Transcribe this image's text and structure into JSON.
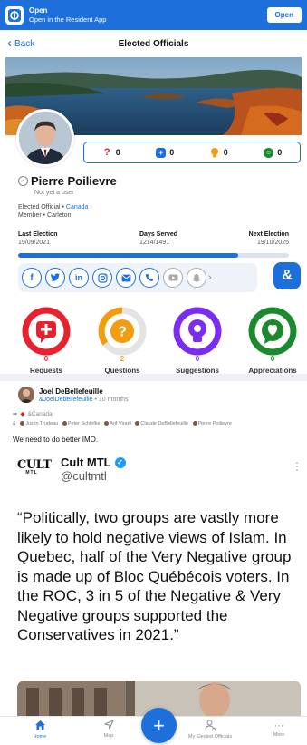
{
  "app_banner": {
    "title": "Open",
    "subtitle": "Open in the Resident App",
    "button": "Open"
  },
  "nav": {
    "back": "Back",
    "title": "Elected Officials"
  },
  "stats": {
    "questions": "0",
    "requests": "0",
    "suggestions": "0",
    "appreciations": "0"
  },
  "profile": {
    "name": "Pierre Poilievre",
    "status": "Not yet a user",
    "elected_prefix": "Elected Official • ",
    "elected_country": "Canada",
    "member": "Member • Carleton"
  },
  "terms": {
    "last_election_label": "Last Election",
    "last_election_value": "19/09/2021",
    "days_served_label": "Days Served",
    "days_served_value": "1214/1491",
    "next_election_label": "Next Election",
    "next_election_value": "19/10/2025",
    "progress_fraction": 0.814
  },
  "social_icons": [
    "facebook-icon",
    "twitter-icon",
    "linkedin-icon",
    "instagram-icon",
    "email-icon",
    "phone-icon",
    "youtube-icon",
    "snapchat-icon"
  ],
  "categories": [
    {
      "label": "Requests",
      "count": "0",
      "color": "#e8212e"
    },
    {
      "label": "Questions",
      "count": "2",
      "color": "#f39c12"
    },
    {
      "label": "Suggestions",
      "count": "0",
      "color": "#7b2cf0"
    },
    {
      "label": "Appreciations",
      "count": "0",
      "color": "#1a8a2c"
    }
  ],
  "post": {
    "author": "Joel DeBellefeuille",
    "handle": "&JoelDebellefeuille",
    "time": " • 10 months",
    "tag": "&Canada",
    "mentions": [
      "Justin Trudeau",
      "Peter Schiefke",
      "Arif Virani",
      "Claude DeBellefeuille",
      "Pierre Poilievre"
    ],
    "text": "We need to do better IMO."
  },
  "tweet": {
    "logo": "CULT",
    "logo_sub": "MTL",
    "name": "Cult MTL",
    "handle": "@cultmtl",
    "body": "“Politically, two groups are vastly more likely to hold negative views of Islam. In Quebec, half of the Very Negative group is made up of Bloc Québécois voters. In the ROC, 3 in 5 of the Negative & Very Negative groups supported the Conservatives in 2021.”"
  },
  "tabs": {
    "home": "Home",
    "map": "Map",
    "officials": "My Elected Officials",
    "more": "More"
  },
  "colors": {
    "accent": "#1d6fdc"
  }
}
